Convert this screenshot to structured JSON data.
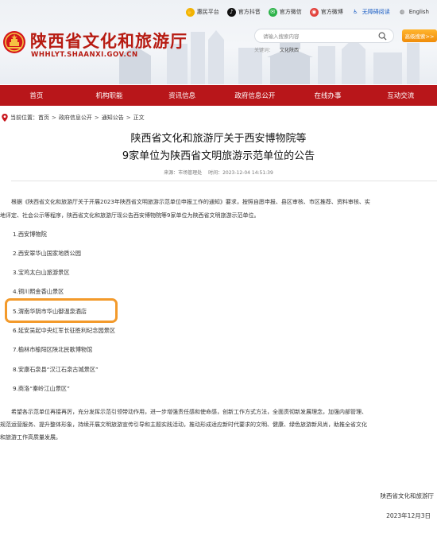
{
  "top_links": [
    {
      "label": "惠民平台",
      "icon": "hand-icon",
      "color": "#f2b400"
    },
    {
      "label": "官方抖音",
      "icon": "tiktok-icon",
      "color": "#111111"
    },
    {
      "label": "官方微信",
      "icon": "wechat-icon",
      "color": "#2db34a"
    },
    {
      "label": "官方微博",
      "icon": "weibo-icon",
      "color": "#e2423c"
    },
    {
      "label": "无障碍阅读",
      "icon": "accessibility-icon",
      "color": "#1d5fc4"
    },
    {
      "label": "English",
      "icon": "globe-icon",
      "color": "#555555"
    }
  ],
  "site": {
    "title": "陕西省文化和旅游厅",
    "url": "WHHLYT.SHAANXI.GOV.CN"
  },
  "search": {
    "placeholder": "请输入搜索内容",
    "hot_label": "关键词：",
    "hot_word": "文化陕西",
    "advanced_label": "高级搜索>>"
  },
  "nav": {
    "items": [
      "首页",
      "机构职能",
      "资讯信息",
      "政府信息公开",
      "在线办事",
      "互动交流"
    ]
  },
  "breadcrumb": {
    "prefix": "当前位置：",
    "items": [
      "首页",
      "政府信息公开",
      "通知公告",
      "正文"
    ],
    "separator": ">"
  },
  "article": {
    "title_line1": "陕西省文化和旅游厅关于西安博物院等",
    "title_line2": "9家单位为陕西省文明旅游示范单位的公告",
    "source": "来源：市场管理处",
    "time": "时间：2023-12-04 14:51:39",
    "intro_line1": "根据《陕西省文化和旅游厅关于开展2023年陕西省文明旅游示范单位申报工作的通知》要求，按照自愿申报、县区审核、市区推荐、资料审核、实",
    "intro_line2": "地评定、社会公示等程序，陕西省文化和旅游厅现公告西安博物院等9家单位为陕西省文明旅游示范单位。",
    "units": [
      "1.西安博物院",
      "2.西安翠华山国家地质公园",
      "3.宝鸡太白山旅游景区",
      "4.铜川照金香山景区",
      "5.渭南华阴市华山御温泉酒店",
      "6.延安吴起中央红军长征胜利纪念园景区",
      "7.榆林市榆阳区陕北民歌博物馆",
      "8.安康石泉县“汉江石泉古城景区”",
      "9.商洛“秦岭江山景区”"
    ],
    "closing_line1": "希望各示范单位再接再厉，充分发挥示范引领带动作用，进一步增强责任感和使命感，创新工作方式方法，全面贯彻新发展理念，加强内部管理、",
    "closing_line2": "规范运营服务、提升整体形象，持续开展文明旅游宣传引导和主题实践活动，推动形成适应新时代要求的文明、健康、绿色旅游新风尚，助推全省文化",
    "closing_line3": "和旅游工作高质量发展。",
    "signature": "陕西省文化和旅游厅",
    "date": "2023年12月3日",
    "highlighted_unit_index": 4
  },
  "colors": {
    "brand_red": "#b8161a",
    "title_red": "#b71b12",
    "highlight_orange": "#f39a2b",
    "button_orange": "#f08c0a"
  }
}
